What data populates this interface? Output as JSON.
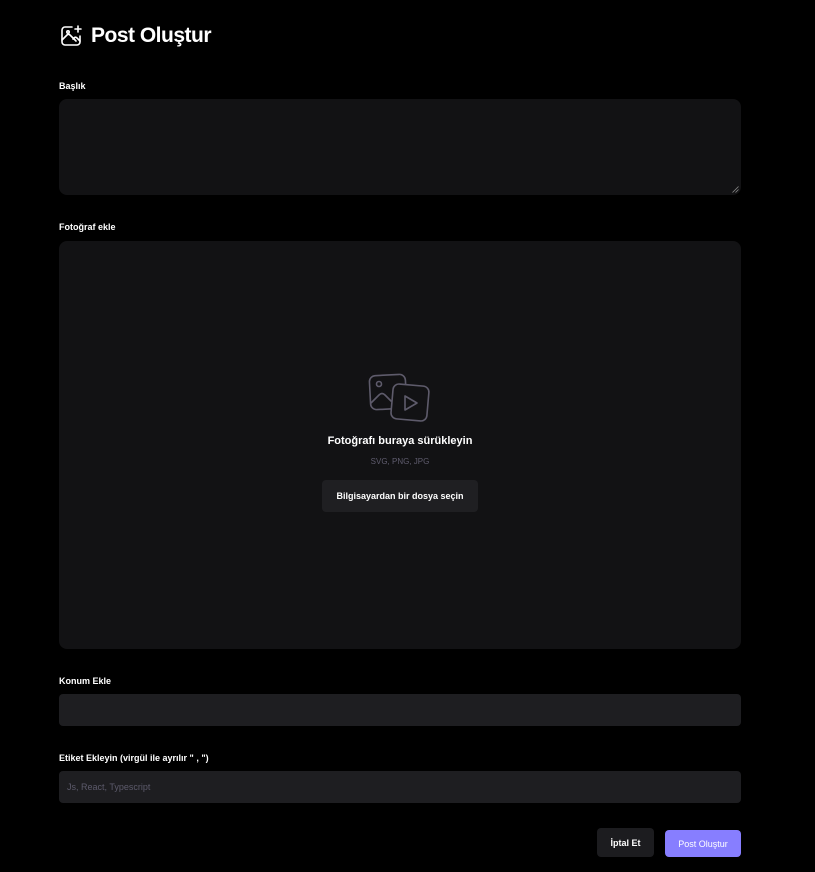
{
  "header": {
    "title": "Post Oluştur",
    "icon": "image-plus-icon"
  },
  "form": {
    "caption": {
      "label": "Başlık",
      "value": ""
    },
    "photo": {
      "label": "Fotoğraf ekle",
      "icon": "image-video-icon",
      "heading": "Fotoğrafı buraya sürükleyin",
      "hint": "SVG, PNG, JPG",
      "button_label": "Bilgisayardan bir dosya seçin"
    },
    "location": {
      "label": "Konum Ekle",
      "value": ""
    },
    "tags": {
      "label": "Etiket Ekleyin (virgül ile ayrılır \" , \")",
      "placeholder": "Js, React, Typescript",
      "value": ""
    }
  },
  "actions": {
    "cancel_label": "İptal Et",
    "submit_label": "Post Oluştur"
  },
  "colors": {
    "background": "#000000",
    "field": "#121214",
    "input": "#1e1e21",
    "accent": "#877eff",
    "muted": "#5c5a6b"
  }
}
